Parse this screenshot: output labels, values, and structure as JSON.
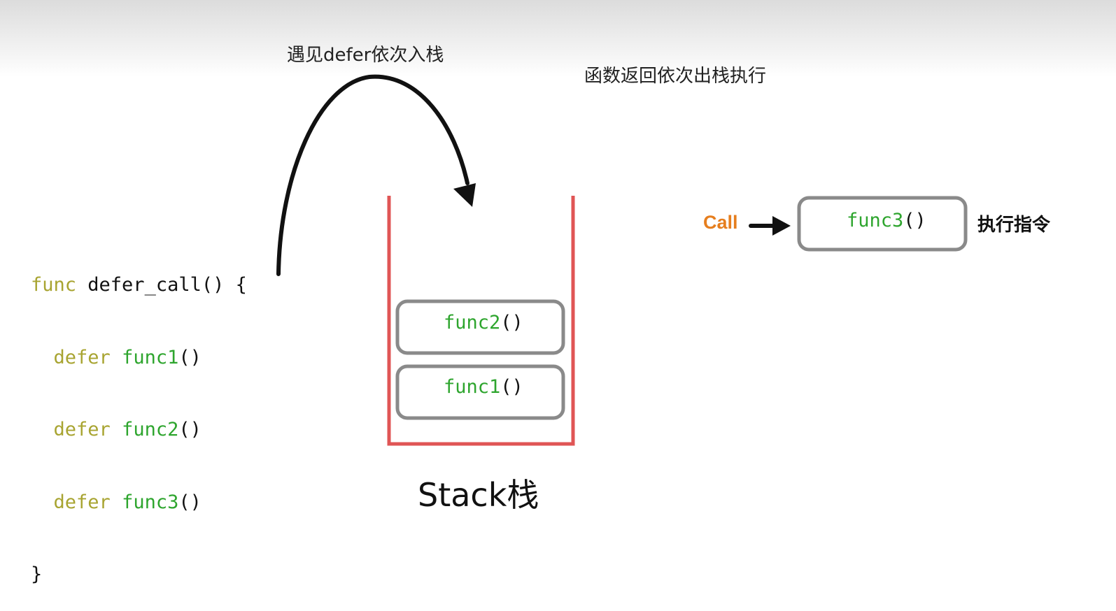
{
  "annotations": {
    "push": "遇见defer依次入栈",
    "pop": "函数返回依次出栈执行"
  },
  "code": {
    "line1": {
      "kw": "func",
      "rest": " defer_call() {"
    },
    "line2": {
      "kw": "defer",
      "fn": "func1",
      "paren": "()"
    },
    "line3": {
      "kw": "defer",
      "fn": "func2",
      "paren": "()"
    },
    "line4": {
      "kw": "defer",
      "fn": "func3",
      "paren": "()"
    },
    "line5": "}"
  },
  "stack": {
    "label": "Stack栈",
    "frames": [
      {
        "fn": "func2",
        "paren": "()"
      },
      {
        "fn": "func1",
        "paren": "()"
      }
    ]
  },
  "execution": {
    "call_label": "Call",
    "frame": {
      "fn": "func3",
      "paren": "()"
    },
    "exec_label": "执行指令"
  },
  "colors": {
    "keyword": "#a8a431",
    "function": "#2ea52e",
    "stack_border": "#e05555",
    "frame_border": "#8a8a8a",
    "call": "#e67e1e"
  }
}
